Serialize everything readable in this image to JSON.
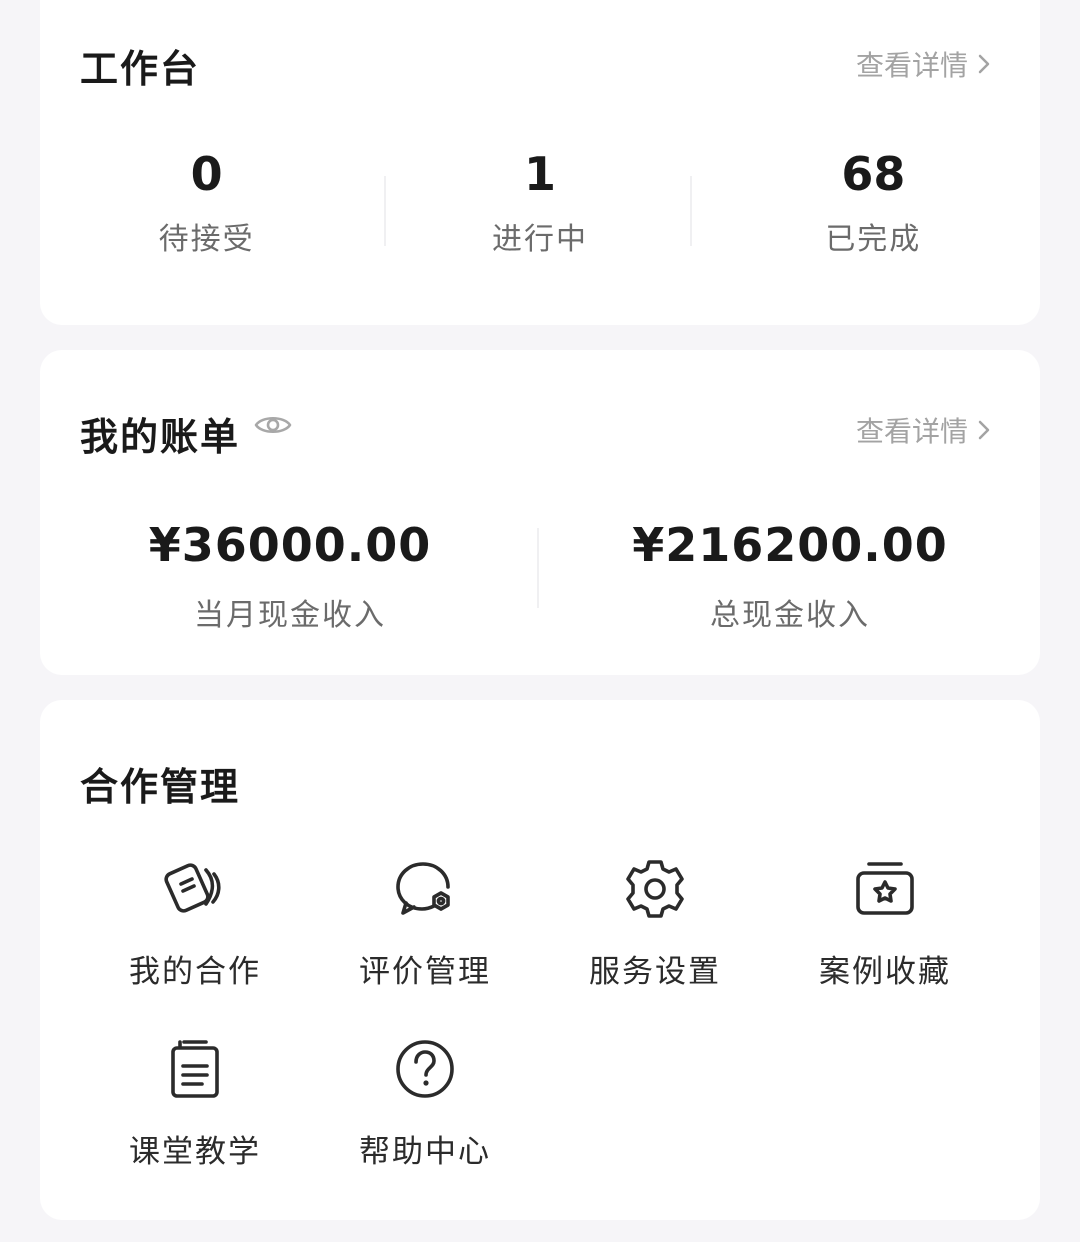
{
  "workbench": {
    "title": "工作台",
    "more": "查看详情",
    "stats": [
      {
        "value": "0",
        "label": "待接受"
      },
      {
        "value": "1",
        "label": "进行中"
      },
      {
        "value": "68",
        "label": "已完成"
      }
    ]
  },
  "bill": {
    "title": "我的账单",
    "more": "查看详情",
    "items": [
      {
        "amount": "¥36000.00",
        "label": "当月现金收入"
      },
      {
        "amount": "¥216200.00",
        "label": "总现金收入"
      }
    ]
  },
  "cooperation": {
    "title": "合作管理",
    "items": [
      {
        "label": "我的合作",
        "icon": "cooperation-icon"
      },
      {
        "label": "评价管理",
        "icon": "review-icon"
      },
      {
        "label": "服务设置",
        "icon": "gear-icon"
      },
      {
        "label": "案例收藏",
        "icon": "star-box-icon"
      },
      {
        "label": "课堂教学",
        "icon": "document-icon"
      },
      {
        "label": "帮助中心",
        "icon": "question-icon"
      }
    ]
  },
  "colors": {
    "background": "#f6f5f8",
    "card": "#ffffff",
    "muted": "#a3a3a3",
    "text": "#1a1a1a"
  }
}
